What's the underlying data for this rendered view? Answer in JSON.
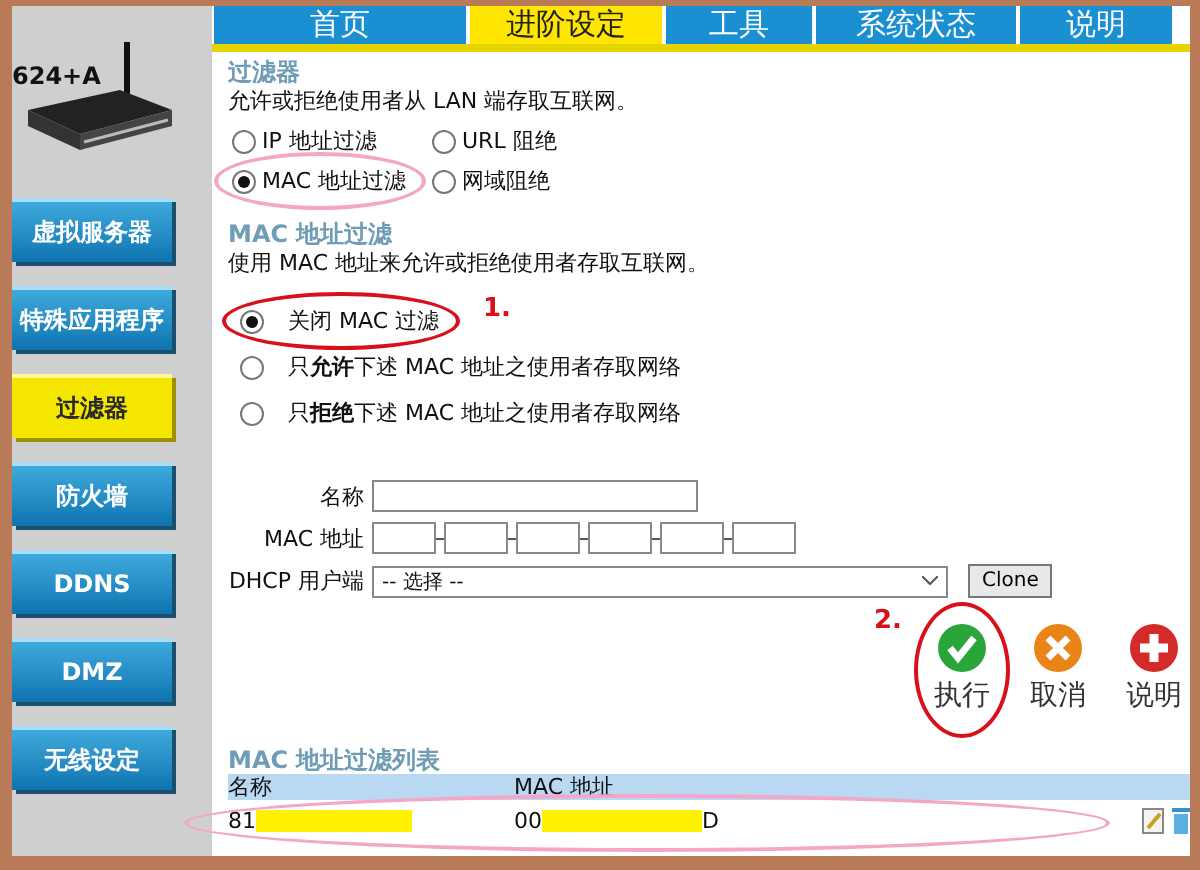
{
  "sidebar": {
    "model_label": "624+A",
    "items": [
      {
        "label": "虚拟服务器",
        "selected": false
      },
      {
        "label": "特殊应用程序",
        "selected": false
      },
      {
        "label": "过滤器",
        "selected": true
      },
      {
        "label": "防火墙",
        "selected": false
      },
      {
        "label": "DDNS",
        "selected": false
      },
      {
        "label": "DMZ",
        "selected": false
      },
      {
        "label": "无线设定",
        "selected": false
      }
    ]
  },
  "tabs": [
    {
      "label": "首页",
      "selected": false
    },
    {
      "label": "进阶设定",
      "selected": true
    },
    {
      "label": "工具",
      "selected": false
    },
    {
      "label": "系统状态",
      "selected": false
    },
    {
      "label": "说明",
      "selected": false
    }
  ],
  "filter": {
    "title": "过滤器",
    "description": "允许或拒绝使用者从 LAN 端存取互联网。",
    "options": [
      {
        "label": "IP 地址过滤",
        "selected": false
      },
      {
        "label": "URL 阻绝",
        "selected": false
      },
      {
        "label": "MAC 地址过滤",
        "selected": true,
        "circled": true,
        "color": "#f4a6c8"
      },
      {
        "label": "网域阻绝",
        "selected": false
      }
    ]
  },
  "mac_filter": {
    "title": "MAC 地址过滤",
    "description": "使用 MAC 地址来允许或拒绝使用者存取互联网。",
    "options": [
      {
        "label": "关闭 MAC 过滤",
        "selected": true,
        "circled": true,
        "color": "#d8101a",
        "note": "1."
      },
      {
        "label": "只**允许**下述 MAC 地址之使用者存取网络",
        "selected": false
      },
      {
        "label": "只**拒绝**下述 MAC 地址之使用者存取网络",
        "selected": false
      }
    ]
  },
  "form": {
    "name_label": "名称",
    "mac_label": "MAC 地址",
    "dhcp_label": "DHCP 用户端",
    "dhcp_value": "-- 选择 --",
    "clone_button": "Clone"
  },
  "actions": [
    {
      "label": "执行",
      "kind": "apply",
      "circled": true,
      "color": "#d8101a",
      "note": "2."
    },
    {
      "label": "取消",
      "kind": "cancel"
    },
    {
      "label": "说明",
      "kind": "help"
    }
  ],
  "list": {
    "title": "MAC 地址过滤列表",
    "columns": [
      "名称",
      "MAC 地址"
    ],
    "rows": [
      {
        "name": "81",
        "mac_start": "00",
        "mac_end": "D",
        "circled": true,
        "color": "#f4a6c8"
      }
    ]
  }
}
